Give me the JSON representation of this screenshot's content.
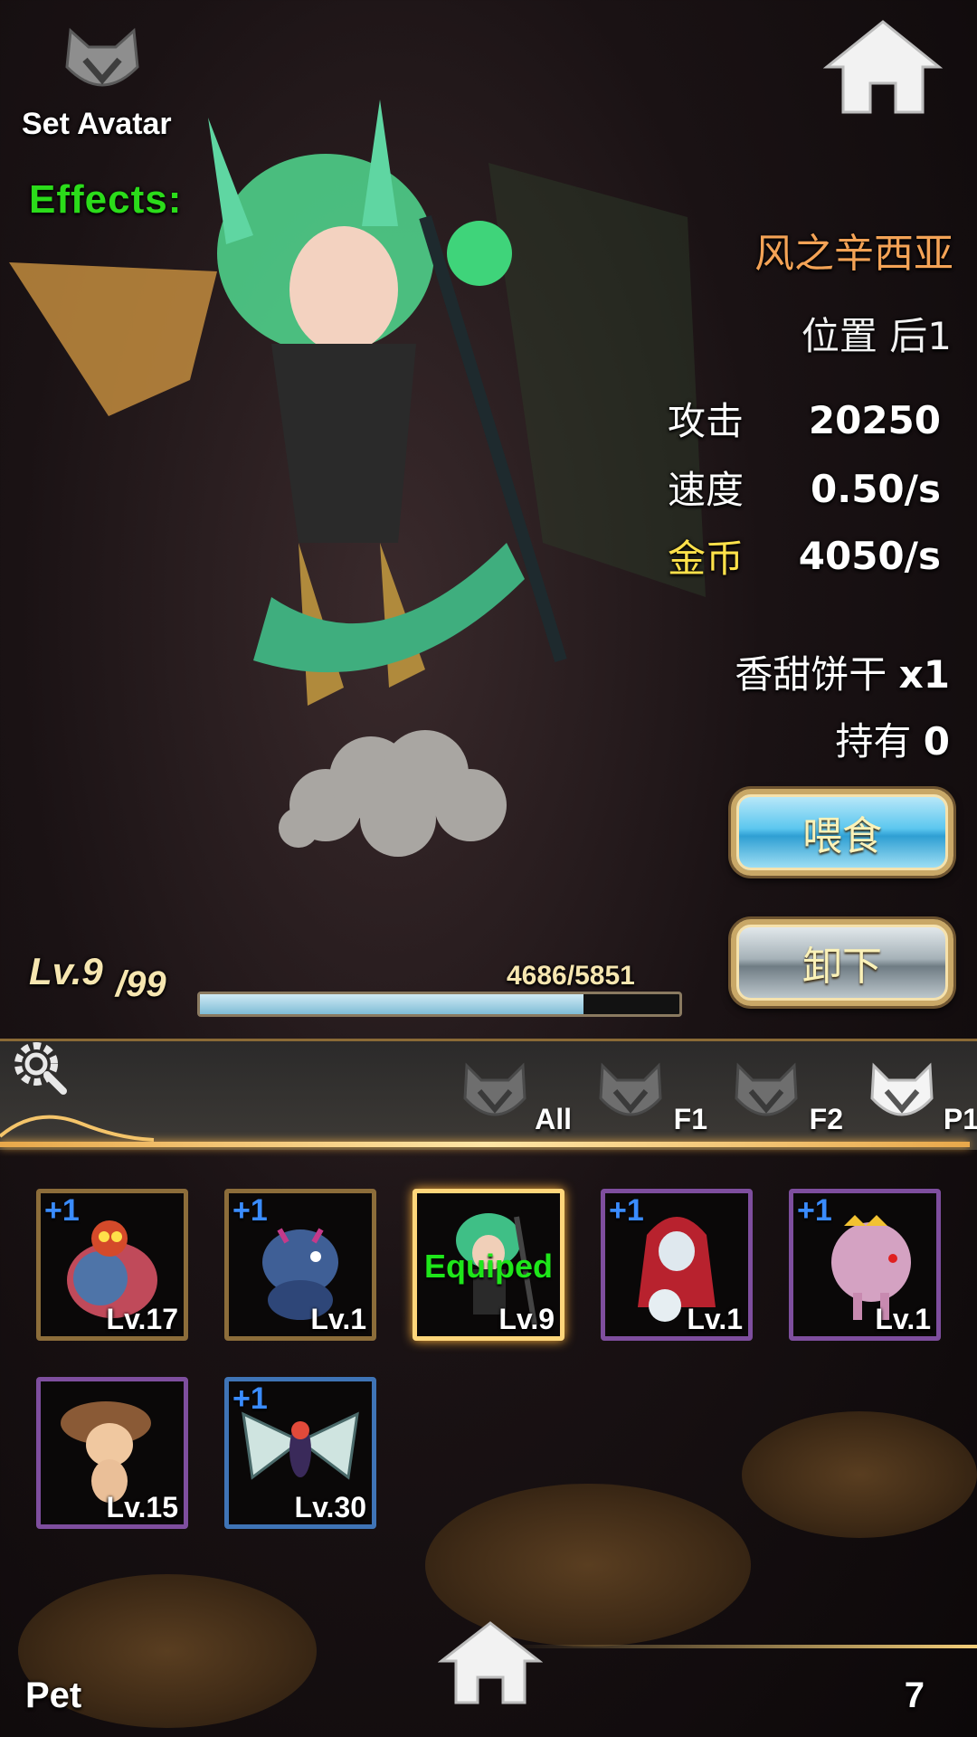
{
  "top": {
    "set_avatar_label": "Set Avatar",
    "effects_label": "Effects:",
    "avatar_icon": "wolf-emblem-icon",
    "home_icon": "home-icon"
  },
  "hero": {
    "name": "风之辛西亚",
    "position": "位置 后1",
    "stats": {
      "attack_label": "攻击",
      "attack_value": "20250",
      "speed_label": "速度",
      "speed_value": "0.50/s",
      "gold_label": "金币",
      "gold_value": "4050/s"
    },
    "food_item": "香甜饼干",
    "food_qty": "x1",
    "own_label": "持有",
    "own_value": "0",
    "feed_label": "喂食",
    "unequip_label": "卸下",
    "level": "Lv.9",
    "level_max": "/99",
    "exp_text": "4686/5851",
    "exp_fraction": 0.8,
    "colors": {
      "name": "#f4a356",
      "effects": "#2bdc1a",
      "gold": "#ffe24a"
    }
  },
  "filters": {
    "settings_icon": "settings-search-icon",
    "tabs": [
      {
        "label": "All"
      },
      {
        "label": "F1"
      },
      {
        "label": "F2"
      },
      {
        "label": "P1"
      }
    ]
  },
  "pets": [
    {
      "plus": "+1",
      "level": "Lv.17",
      "frame": "gold"
    },
    {
      "plus": "+1",
      "level": "Lv.1",
      "frame": "gold"
    },
    {
      "plus": "",
      "level": "Lv.9",
      "frame": "equipped",
      "status": "Equiped"
    },
    {
      "plus": "+1",
      "level": "Lv.1",
      "frame": "purple"
    },
    {
      "plus": "+1",
      "level": "Lv.1",
      "frame": "purple"
    },
    {
      "plus": "",
      "level": "Lv.15",
      "frame": "purple"
    },
    {
      "plus": "+1",
      "level": "Lv.30",
      "frame": "blue"
    }
  ],
  "bottom": {
    "title": "Pet",
    "count": "7"
  }
}
